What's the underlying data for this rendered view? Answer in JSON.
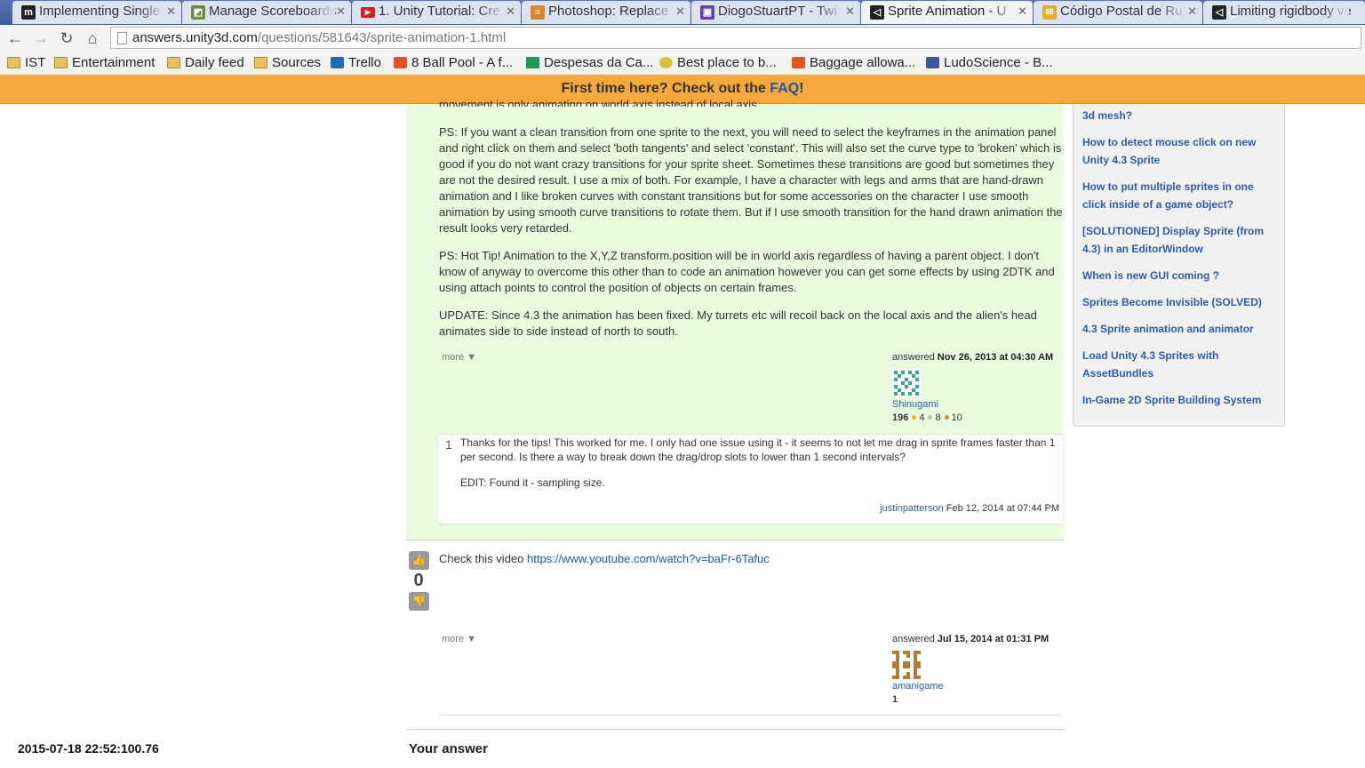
{
  "browser": {
    "tabs": [
      {
        "title": "Implementing Single",
        "icon": "medium-m-icon"
      },
      {
        "title": "Manage Scoreboards",
        "icon": "scoreboard-icon"
      },
      {
        "title": "1. Unity Tutorial: Cre",
        "icon": "youtube-icon"
      },
      {
        "title": "Photoshop: Replace",
        "icon": "stackexchange-icon"
      },
      {
        "title": "DiogoStuartPT - Twi",
        "icon": "twitch-icon"
      },
      {
        "title": "Sprite Animation - U",
        "icon": "unity-icon"
      },
      {
        "title": "Código Postal de Ru",
        "icon": "bookmark-icon"
      },
      {
        "title": "Limiting rigidbody ve",
        "icon": "unity-icon"
      }
    ],
    "url_host": "answers.unity3d.com",
    "url_path": "/questions/581643/sprite-animation-1.html",
    "bookmarks": [
      "IST",
      "Entertainment",
      "Daily feed",
      "Sources",
      "Trello",
      "8 Ball Pool - A f...",
      "Despesas da Ca...",
      "Best place to b...",
      "Baggage allowa...",
      "LudoScience - B..."
    ]
  },
  "faq_bar": {
    "text": "First time here? Check out the ",
    "link": "FAQ",
    "tail": "!"
  },
  "answer1": {
    "clipped_line": "movement is only animating on world axis instead of local axis.",
    "p1": "PS: If you want a clean transition from one sprite to the next, you will need to select the keyframes in the animation panel and right click on them and select 'both tangents' and select 'constant'. This will also set the curve type to 'broken' which is good if you do not want crazy transitions for your sprite sheet. Sometimes these transitions are good but sometimes they are not the desired result. I use a mix of both. For example, I have a character with legs and arms that are hand-drawn animation and I like broken curves with constant transitions but for some accessories on the character I use smooth animation by using smooth curve transitions to rotate them. But if I use smooth transition for the hand drawn animation the result looks very retarded.",
    "p2": "PS: Hot Tip! Animation to the X,Y,Z transform.position will be in world axis regardless of having a parent object. I don't know of anyway to overcome this other than to code an animation however you can get some effects by using 2DTK and using attach points to control the position of objects on certain frames.",
    "p3": "UPDATE: Since 4.3 the animation has been fixed. My turrets etc will recoil back on the local axis and the alien's head animates side to side instead of north to south.",
    "more": "more ▼",
    "answered_label": "answered",
    "answered_date": "Nov 26, 2013 at 04:30 AM",
    "user": "Shinugami",
    "rep": "196",
    "gold": "4",
    "silver": "8",
    "bronze": "10"
  },
  "comment": {
    "votes": "1",
    "text1": "Thanks for the tips! This worked for me. I only had one issue using it - it seems to not let me drag in sprite frames faster than 1 per second. Is there a way to break down the drag/drop slots to lower than 1 second intervals?",
    "text2": "EDIT: Found it - sampling size.",
    "user": "justinpatterson",
    "date": "Feb 12, 2014 at 07:44 PM"
  },
  "answer2": {
    "votes": "0",
    "text": "Check this video ",
    "link": "https://www.youtube.com/watch?v=baFr-6Tafuc",
    "more": "more ▼",
    "answered_label": "answered",
    "answered_date": "Jul 15, 2014 at 01:31 PM",
    "user": "amanigame",
    "rep": "1"
  },
  "your_answer": "Your answer",
  "sidebar": {
    "items": [
      "3d mesh?",
      "How to detect mouse click on new Unity 4.3 Sprite",
      "How to put multiple sprites in one click inside of a game object?",
      "[SOLUTIONED] Display Sprite (from 4.3) in an EditorWindow",
      "When is new GUI coming ?",
      "Sprites Become Invisible (SOLVED)",
      "4.3 Sprite animation and animator",
      "Load Unity 4.3 Sprites with AssetBundles",
      "In-Game 2D Sprite Building System"
    ]
  },
  "timestamp": "2015-07-18 22:52:100.76",
  "colors": {
    "faq_bar": "#f5a83b",
    "accepted_bg": "#e9fbdf",
    "link": "#1e58a6"
  }
}
